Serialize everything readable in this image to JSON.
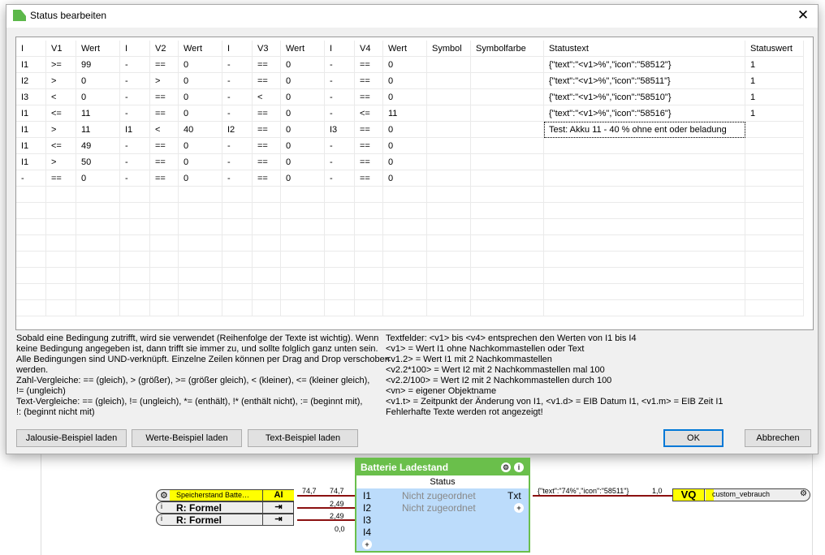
{
  "dialog": {
    "title": "Status bearbeiten",
    "close_label": "✕"
  },
  "table": {
    "headers": [
      "I",
      "V1",
      "Wert",
      "I",
      "V2",
      "Wert",
      "I",
      "V3",
      "Wert",
      "I",
      "V4",
      "Wert",
      "Symbol",
      "Symbolfarbe",
      "Statustext",
      "Statuswert"
    ],
    "rows": [
      [
        "I1",
        ">=",
        "99",
        "-",
        "==",
        "0",
        "-",
        "==",
        "0",
        "-",
        "==",
        "0",
        "",
        "",
        "{\"text\":\"<v1>%\",\"icon\":\"58512\"}",
        "1"
      ],
      [
        "I2",
        ">",
        "0",
        "-",
        ">",
        "0",
        "-",
        "==",
        "0",
        "-",
        "==",
        "0",
        "",
        "",
        "{\"text\":\"<v1>%\",\"icon\":\"58511\"}",
        "1"
      ],
      [
        "I3",
        "<",
        "0",
        "-",
        "==",
        "0",
        "-",
        "<",
        "0",
        "-",
        "==",
        "0",
        "",
        "",
        "{\"text\":\"<v1>%\",\"icon\":\"58510\"}",
        "1"
      ],
      [
        "I1",
        "<=",
        "11",
        "-",
        "==",
        "0",
        "-",
        "==",
        "0",
        "-",
        "<=",
        "11",
        "",
        "",
        "{\"text\":\"<v1>%\",\"icon\":\"58516\"}",
        "1"
      ],
      [
        "I1",
        ">",
        "11",
        "I1",
        "<",
        "40",
        "I2",
        "==",
        "0",
        "I3",
        "==",
        "0",
        "",
        "",
        "Test: Akku 11 - 40 % ohne ent oder beladung",
        ""
      ],
      [
        "I1",
        "<=",
        "49",
        "-",
        "==",
        "0",
        "-",
        "==",
        "0",
        "-",
        "==",
        "0",
        "",
        "",
        "",
        ""
      ],
      [
        "I1",
        ">",
        "50",
        "-",
        "==",
        "0",
        "-",
        "==",
        "0",
        "-",
        "==",
        "0",
        "",
        "",
        "",
        ""
      ],
      [
        "-",
        "==",
        "0",
        "-",
        "==",
        "0",
        "-",
        "==",
        "0",
        "-",
        "==",
        "0",
        "",
        "",
        "",
        ""
      ]
    ]
  },
  "help_left": "Sobald eine Bedingung zutrifft, wird sie verwendet (Reihenfolge der Texte ist wichtig). Wenn\nkeine Bedingung angegeben ist, dann trifft sie immer zu, und sollte folglich ganz unten sein.\nAlle Bedingungen sind UND-verknüpft. Einzelne Zeilen können per Drag and Drop verschoben\nwerden.\nZahl-Vergleiche: == (gleich), > (größer), >= (größer gleich), < (kleiner), <= (kleiner gleich),\n!= (ungleich)\nText-Vergleiche: == (gleich), != (ungleich), *= (enthält), !* (enthält nicht), := (beginnt mit),\n!: (beginnt nicht mit)",
  "help_right": "Textfelder: <v1> bis <v4> entsprechen den Werten von I1 bis I4\n<v1> = Wert I1 ohne Nachkommastellen oder Text\n<v1.2> = Wert I1 mit 2 Nachkommastellen\n<v2.2*100> = Wert I2 mit 2 Nachkommastellen mal 100\n<v2.2/100> = Wert I2 mit 2 Nachkommastellen durch 100\n<vn> = eigener Objektname\n<v1.t> = Zeitpunkt der Änderung von I1, <v1.d> = EIB Datum I1, <v1.m> = EIB Zeit I1\nFehlerhafte Texte werden rot angezeigt!",
  "buttons": {
    "jalousie": "Jalousie-Beispiel laden",
    "werte": "Werte-Beispiel laden",
    "text": "Text-Beispiel laden",
    "ok": "OK",
    "cancel": "Abbrechen"
  },
  "diagram": {
    "node_title": "Batterie Ladestand",
    "node_sub": "Status",
    "inputs": [
      "I1",
      "I2",
      "I3",
      "I4"
    ],
    "output": "Txt",
    "unassigned": [
      "Nicht zugeordnet",
      "Nicht zugeordnet"
    ],
    "src1": {
      "name": "Speicherstand Batte…",
      "type": "AI"
    },
    "src2": {
      "name": "R: Formel"
    },
    "src3": {
      "name": "R: Formel"
    },
    "values_out": [
      "74,7",
      "2,49",
      "2,49"
    ],
    "values_in": [
      "74,7",
      "2,49",
      "2,49",
      "0,0"
    ],
    "out_value": "{\"text\":\"74%\",\"icon\":\"58511\"}",
    "out_num": "1,0",
    "target": {
      "type": "VQ",
      "name": "custom_vebrauch"
    }
  }
}
